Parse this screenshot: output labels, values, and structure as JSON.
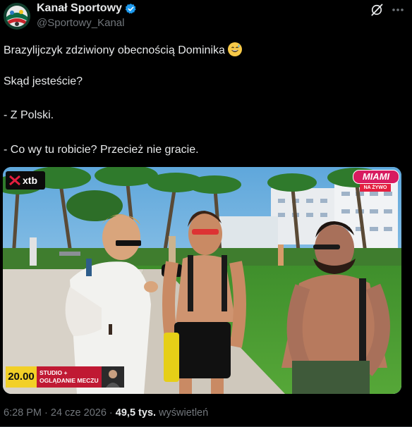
{
  "author": {
    "display_name": "Kanał Sportowy",
    "handle": "@Sportowy_Kanal"
  },
  "icons": {
    "avatar": "channel-logo-icon",
    "verified": "verified-badge-icon",
    "grok": "grok-icon",
    "more": "more-options-icon",
    "emoji": "sweat-smile-emoji-icon"
  },
  "tweet": {
    "line1": "Brazylijczyk zdziwiony obecnością Dominika",
    "line2": "Skąd jesteście?",
    "line3": "- Z Polski.",
    "line4": "- Co wy tu robicie? Przecież nie gracie."
  },
  "media": {
    "sponsor": "xtb",
    "badge_city": "MIAMI",
    "badge_sub": "NA ŻYWO",
    "time": "20.00",
    "studio": "STUDIO +",
    "program": "OGLĄDANIE MECZU"
  },
  "meta": {
    "time": "6:28 PM",
    "sep1": " · ",
    "date": "24 cze 2026",
    "sep2": " · ",
    "views_count": "49,5 tys.",
    "views_label": " wyświetleń"
  },
  "colors": {
    "accent_verified": "#1d9bf0",
    "text_primary": "#e7e9ea",
    "text_secondary": "#71767b",
    "badge_red": "#e41e3f",
    "badge_pink": "#d81b60",
    "time_yellow": "#f2d027"
  }
}
